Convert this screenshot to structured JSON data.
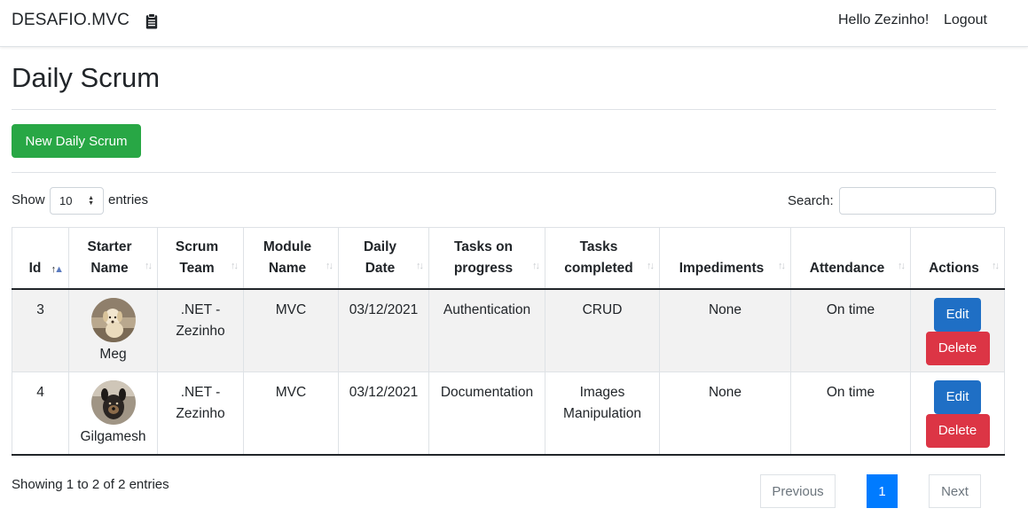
{
  "navbar": {
    "brand": "DESAFIO.MVC",
    "brand_icon": "clipboard-icon",
    "greeting": "Hello Zezinho!",
    "logout": "Logout"
  },
  "page": {
    "title": "Daily Scrum",
    "new_button": "New Daily Scrum"
  },
  "length": {
    "show_label": "Show",
    "selected": "10",
    "entries_label": "entries"
  },
  "search": {
    "label": "Search:",
    "value": ""
  },
  "table": {
    "columns": [
      {
        "line1": "",
        "line2": "Id"
      },
      {
        "line1": "Starter",
        "line2": "Name"
      },
      {
        "line1": "Scrum",
        "line2": "Team"
      },
      {
        "line1": "Module",
        "line2": "Name"
      },
      {
        "line1": "Daily",
        "line2": "Date"
      },
      {
        "line1": "Tasks on",
        "line2": "progress"
      },
      {
        "line1": "Tasks",
        "line2": "completed"
      },
      {
        "line1": "",
        "line2": "Impediments"
      },
      {
        "line1": "",
        "line2": "Attendance"
      },
      {
        "line1": "",
        "line2": "Actions"
      }
    ],
    "rows": [
      {
        "id": "3",
        "starter_name": "Meg",
        "team_line1": ".NET -",
        "team_line2": "Zezinho",
        "module": "MVC",
        "date": "03/12/2021",
        "tasks_progress": "Authentication",
        "tasks_completed_line1": "CRUD",
        "tasks_completed_line2": "",
        "impediments": "None",
        "attendance": "On time",
        "edit": "Edit",
        "delete": "Delete"
      },
      {
        "id": "4",
        "starter_name": "Gilgamesh",
        "team_line1": ".NET -",
        "team_line2": "Zezinho",
        "module": "MVC",
        "date": "03/12/2021",
        "tasks_progress": "Documentation",
        "tasks_completed_line1": "Images",
        "tasks_completed_line2": "Manipulation",
        "impediments": "None",
        "attendance": "On time",
        "edit": "Edit",
        "delete": "Delete"
      }
    ]
  },
  "footer": {
    "info": "Showing 1 to 2 of 2 entries",
    "previous": "Previous",
    "current_page": "1",
    "next": "Next"
  },
  "colors": {
    "success": "#28a745",
    "primary": "#007bff",
    "danger": "#dc3545",
    "edit": "#1f6fc5"
  }
}
